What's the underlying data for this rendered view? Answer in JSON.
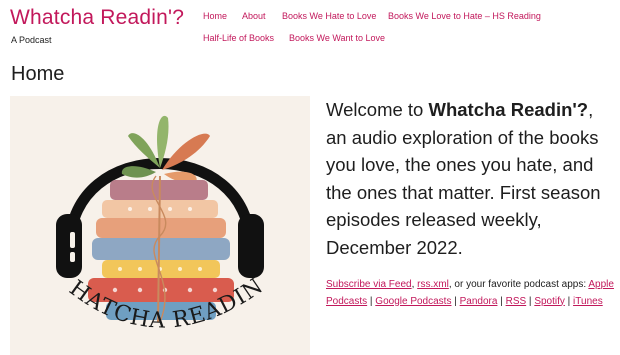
{
  "site": {
    "title": "Whatcha Readin'?",
    "tagline": "A Podcast"
  },
  "nav": {
    "items": [
      {
        "label": "Home"
      },
      {
        "label": "About"
      },
      {
        "label": "Books We Hate to Love"
      },
      {
        "label": "Books We Love to Hate – HS Reading"
      },
      {
        "label": "Half-Life of Books"
      },
      {
        "label": "Books We Want to Love"
      }
    ]
  },
  "page": {
    "title": "Home"
  },
  "cover": {
    "logo_text": "WHATCHA READIN'?"
  },
  "intro": {
    "lead": "Welcome to ",
    "name": "Whatcha Readin'?",
    "rest": ", an audio exploration of the books you love, the ones you hate, and the ones that matter. First season episodes released weekly, December 2022."
  },
  "subscribe": {
    "feed_label": "Subscribe via Feed",
    "sep1": ", ",
    "rss_label": "rss.xml",
    "middle": ", or your favorite podcast apps: ",
    "apps": [
      "Apple Podcasts",
      "Google Podcasts",
      "Pandora",
      "RSS",
      "Spotify",
      "iTunes"
    ],
    "divider": " | "
  },
  "colors": {
    "accent": "#c2185b",
    "text": "#1e1e1e",
    "cover_bg": "#f7f1ea"
  }
}
